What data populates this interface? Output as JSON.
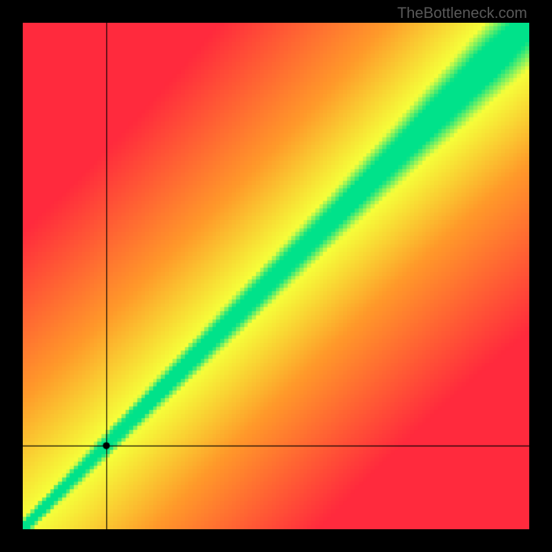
{
  "watermark": "TheBottleneck.com",
  "chart_data": {
    "type": "heatmap",
    "title": "",
    "xlabel": "",
    "ylabel": "",
    "x_range": [
      0,
      1
    ],
    "y_range": [
      0,
      1
    ],
    "crosshair": {
      "x": 0.165,
      "y": 0.165
    },
    "marker": {
      "x": 0.165,
      "y": 0.165
    },
    "ideal_curve": {
      "description": "Ideal pairing diagonal with slight S-shape; green band along it",
      "points": [
        [
          0.0,
          0.0
        ],
        [
          0.1,
          0.095
        ],
        [
          0.2,
          0.195
        ],
        [
          0.3,
          0.3
        ],
        [
          0.4,
          0.405
        ],
        [
          0.5,
          0.51
        ],
        [
          0.6,
          0.615
        ],
        [
          0.7,
          0.715
        ],
        [
          0.8,
          0.81
        ],
        [
          0.9,
          0.895
        ],
        [
          1.0,
          0.97
        ]
      ]
    },
    "band_halfwidth_low": 0.018,
    "band_halfwidth_high": 0.075,
    "color_stops": {
      "optimal": "#00e28a",
      "near": "#f6ff3a",
      "mid": "#ff9a2a",
      "far": "#ff2a3d"
    },
    "grid_n": 128
  }
}
